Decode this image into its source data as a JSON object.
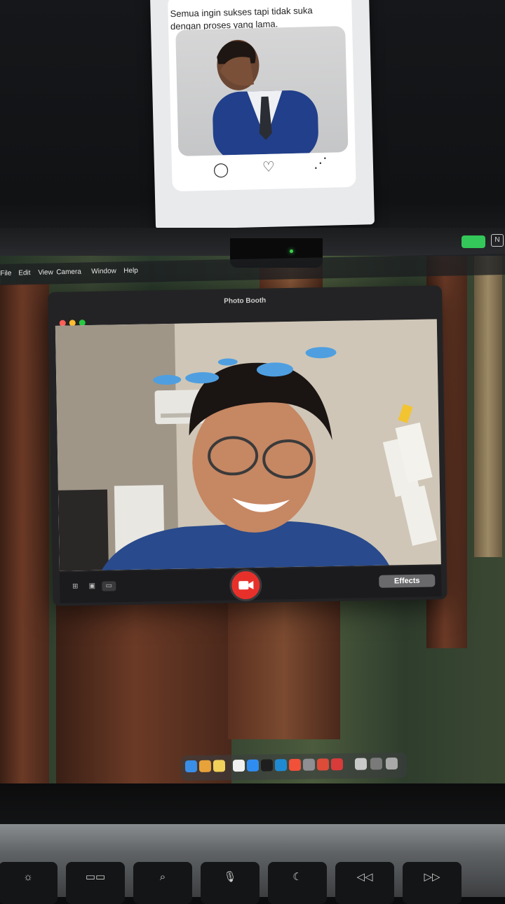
{
  "phone_post": {
    "caption": "Semua ingin sukses tapi tidak suka dengan proses yang lama.",
    "actions": [
      {
        "name": "comment-icon",
        "glyph": "◯"
      },
      {
        "name": "like-icon",
        "glyph": "♡"
      },
      {
        "name": "share-icon",
        "glyph": "⋰"
      }
    ]
  },
  "menubar": {
    "items": [
      "File",
      "Edit",
      "View",
      "Camera",
      "Window",
      "Help"
    ]
  },
  "photo_booth": {
    "title": "Photo Booth",
    "effects_label": "Effects",
    "shutter_icon": "video-camera-icon",
    "view_buttons": [
      "grid-view-icon",
      "single-photo-icon",
      "video-mode-icon"
    ]
  },
  "dock": {
    "apps": [
      "finder-icon",
      "launchpad-icon",
      "notes-icon",
      "notion-icon",
      "app-store-icon",
      "terminal-icon",
      "vscode-icon",
      "swift-icon",
      "settings-icon",
      "chrome-icon",
      "reminder-icon",
      "preview-icon",
      "downloads-icon",
      "trash-icon"
    ]
  },
  "keyboard": {
    "keys": [
      "☼",
      "▭▭",
      "⌕",
      "🎙",
      "☾",
      "◁◁",
      "▷▷"
    ]
  },
  "colors": {
    "accent_red": "#e8302b",
    "tray_green": "#34c759"
  }
}
